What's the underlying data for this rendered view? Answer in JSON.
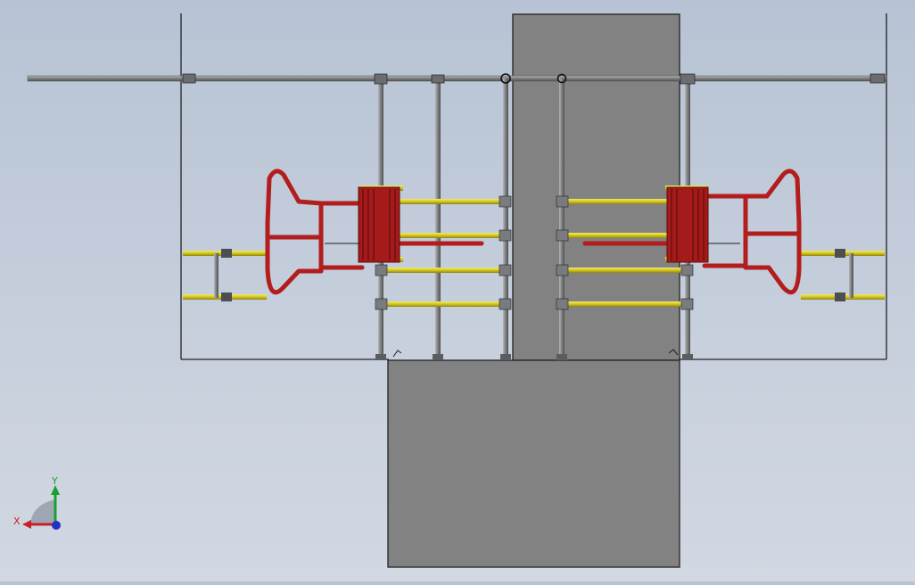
{
  "view": {
    "background_top": "#b7c3d4",
    "background_bottom": "#d2d8e2"
  },
  "colors": {
    "rail_grey": "#8e8f91",
    "rail_dark": "#5a5b5e",
    "slab": "#828282",
    "outline": "#222222",
    "handrail_yellow": "#d8cc2a",
    "frame_red": "#b21d1d",
    "axis_x": "#c8202a",
    "axis_y": "#18a032",
    "axis_z": "#2230c8"
  },
  "triad": {
    "x_label": "X",
    "y_label": "Y",
    "icon": "coordinate-triad-icon"
  }
}
